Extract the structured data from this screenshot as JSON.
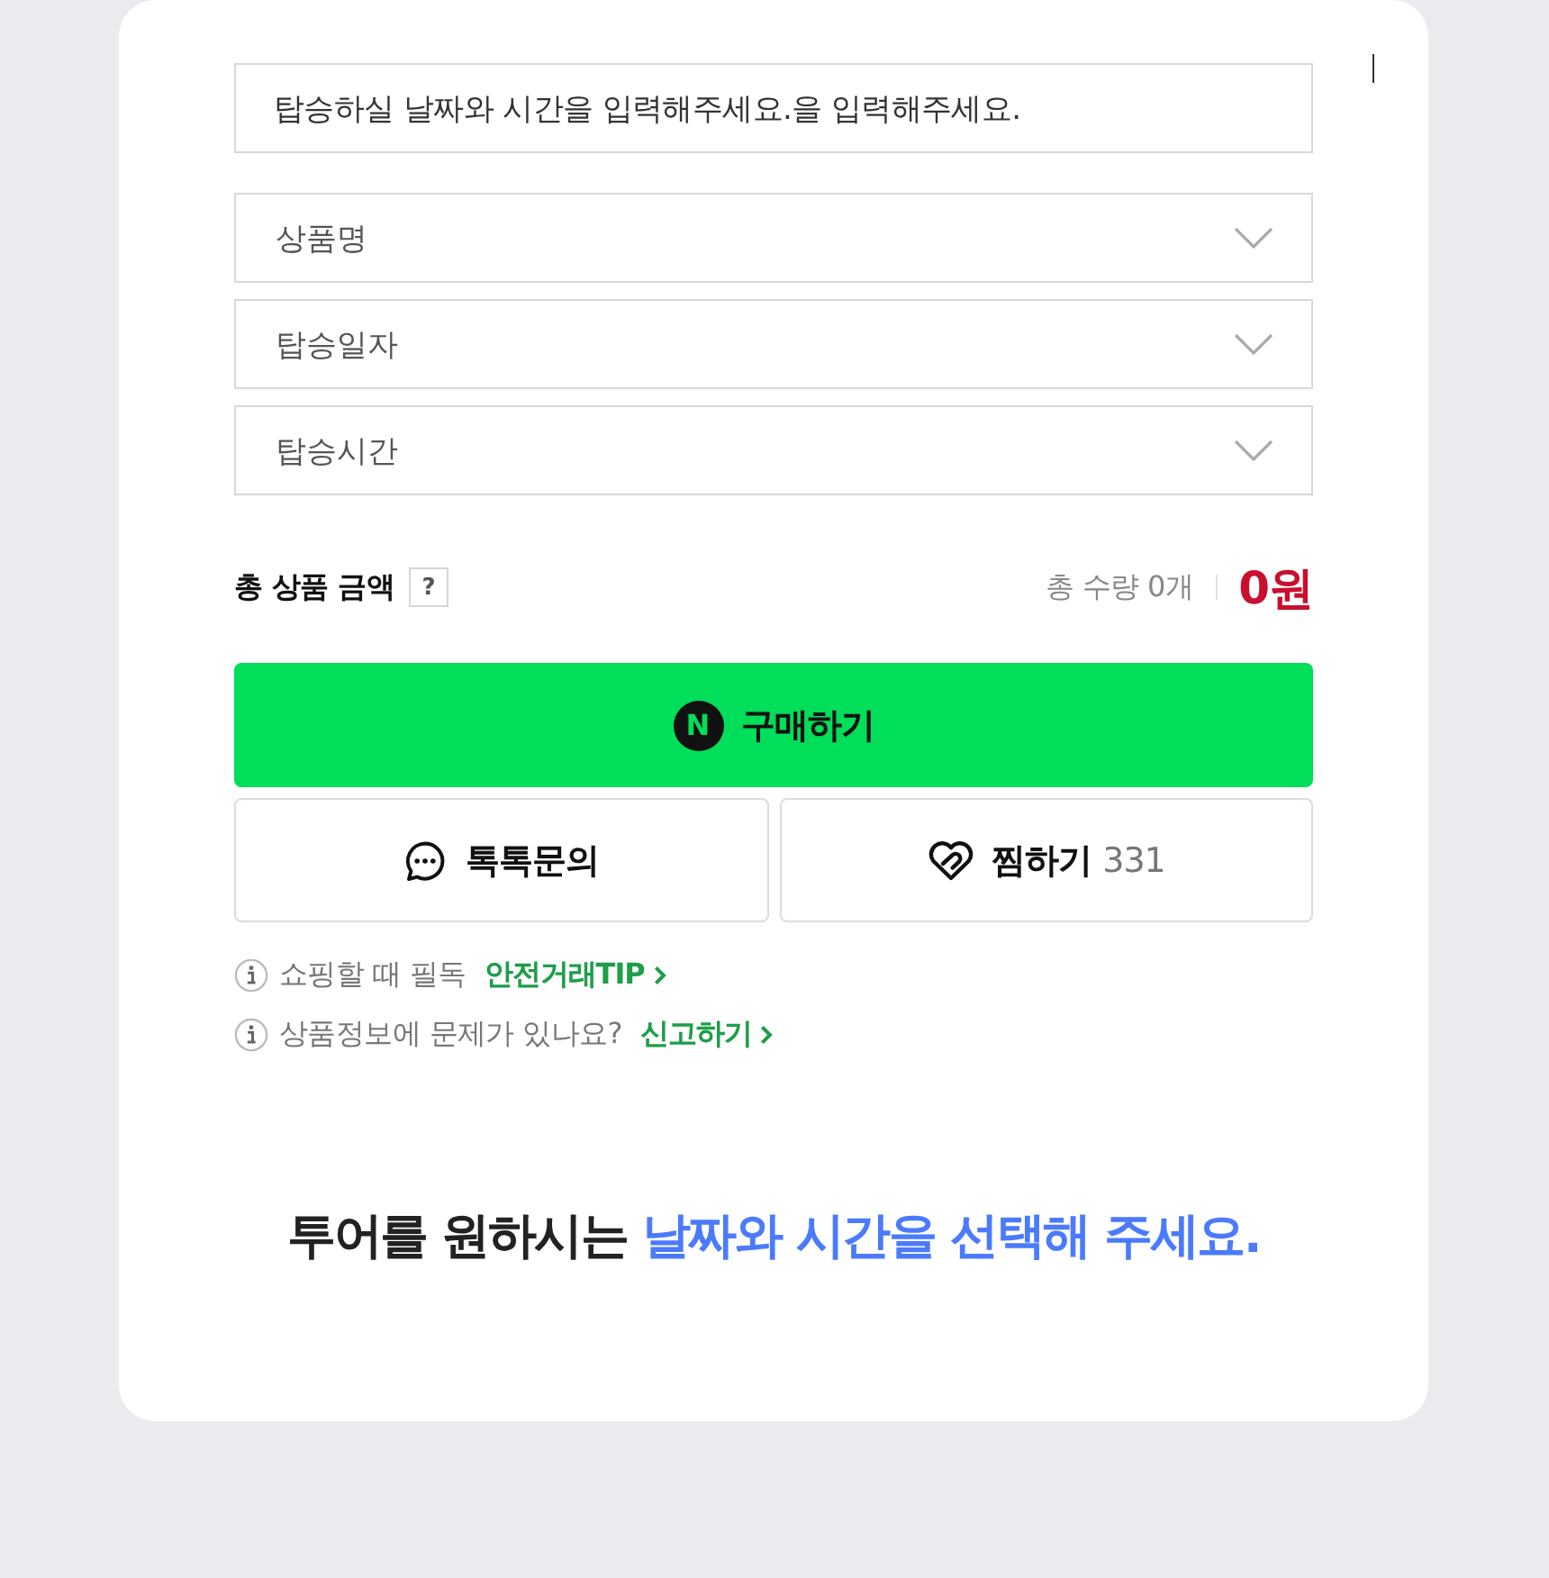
{
  "booking_field": {
    "value": "탑승하실 날짜와 시간을 입력해주세요.을 입력해주세요."
  },
  "selects": [
    {
      "label": "상품명"
    },
    {
      "label": "탑승일자"
    },
    {
      "label": "탑승시간"
    }
  ],
  "total": {
    "label": "총 상품 금액",
    "help": "?",
    "quantity": "총 수량 0개",
    "price": "0원"
  },
  "buy_button": {
    "logo": "N",
    "label": "구매하기"
  },
  "actions": [
    {
      "kind": "talk",
      "label": "톡톡문의"
    },
    {
      "kind": "wish",
      "label": "찜하기",
      "count": "331"
    }
  ],
  "notices": [
    {
      "text": "쇼핑할 때 필독",
      "link": "안전거래TIP"
    },
    {
      "text": "상품정보에 문제가 있나요?",
      "link": "신고하기"
    }
  ],
  "prompt": {
    "lead": "투어를 원하시는",
    "highlight": "날짜와 시간을 선택해 주세요."
  }
}
